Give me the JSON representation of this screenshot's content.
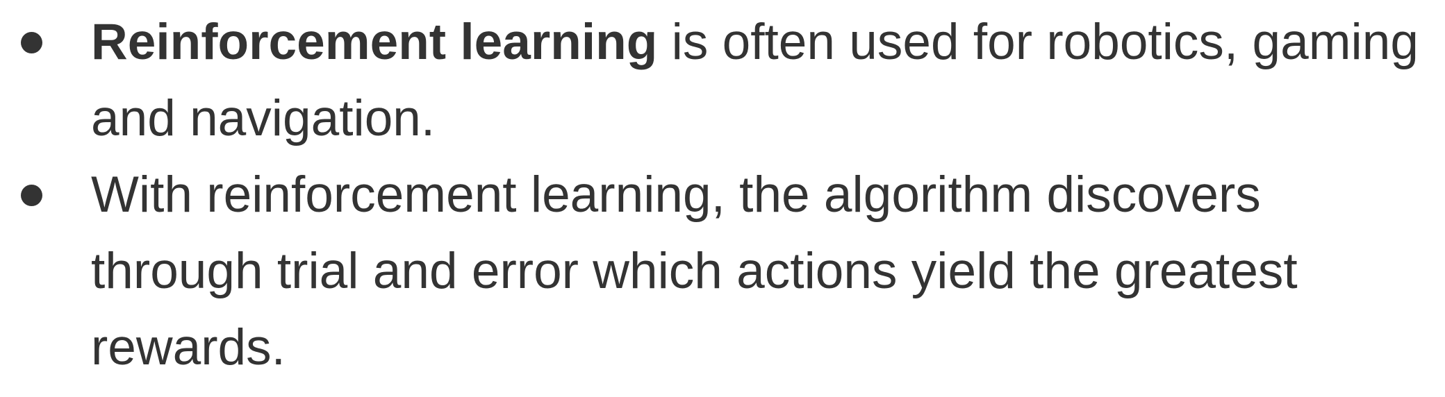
{
  "bullets": [
    {
      "bold_text": "Reinforcement learning",
      "text": " is often used for robotics, gaming and navigation."
    },
    {
      "bold_text": "",
      "text": "With reinforcement learning, the algorithm discovers through trial and error which actions yield the greatest rewards."
    }
  ],
  "colors": {
    "text": "#333333",
    "background": "#ffffff"
  },
  "icons": {
    "bullet": "filled-circle-bullet-icon"
  }
}
